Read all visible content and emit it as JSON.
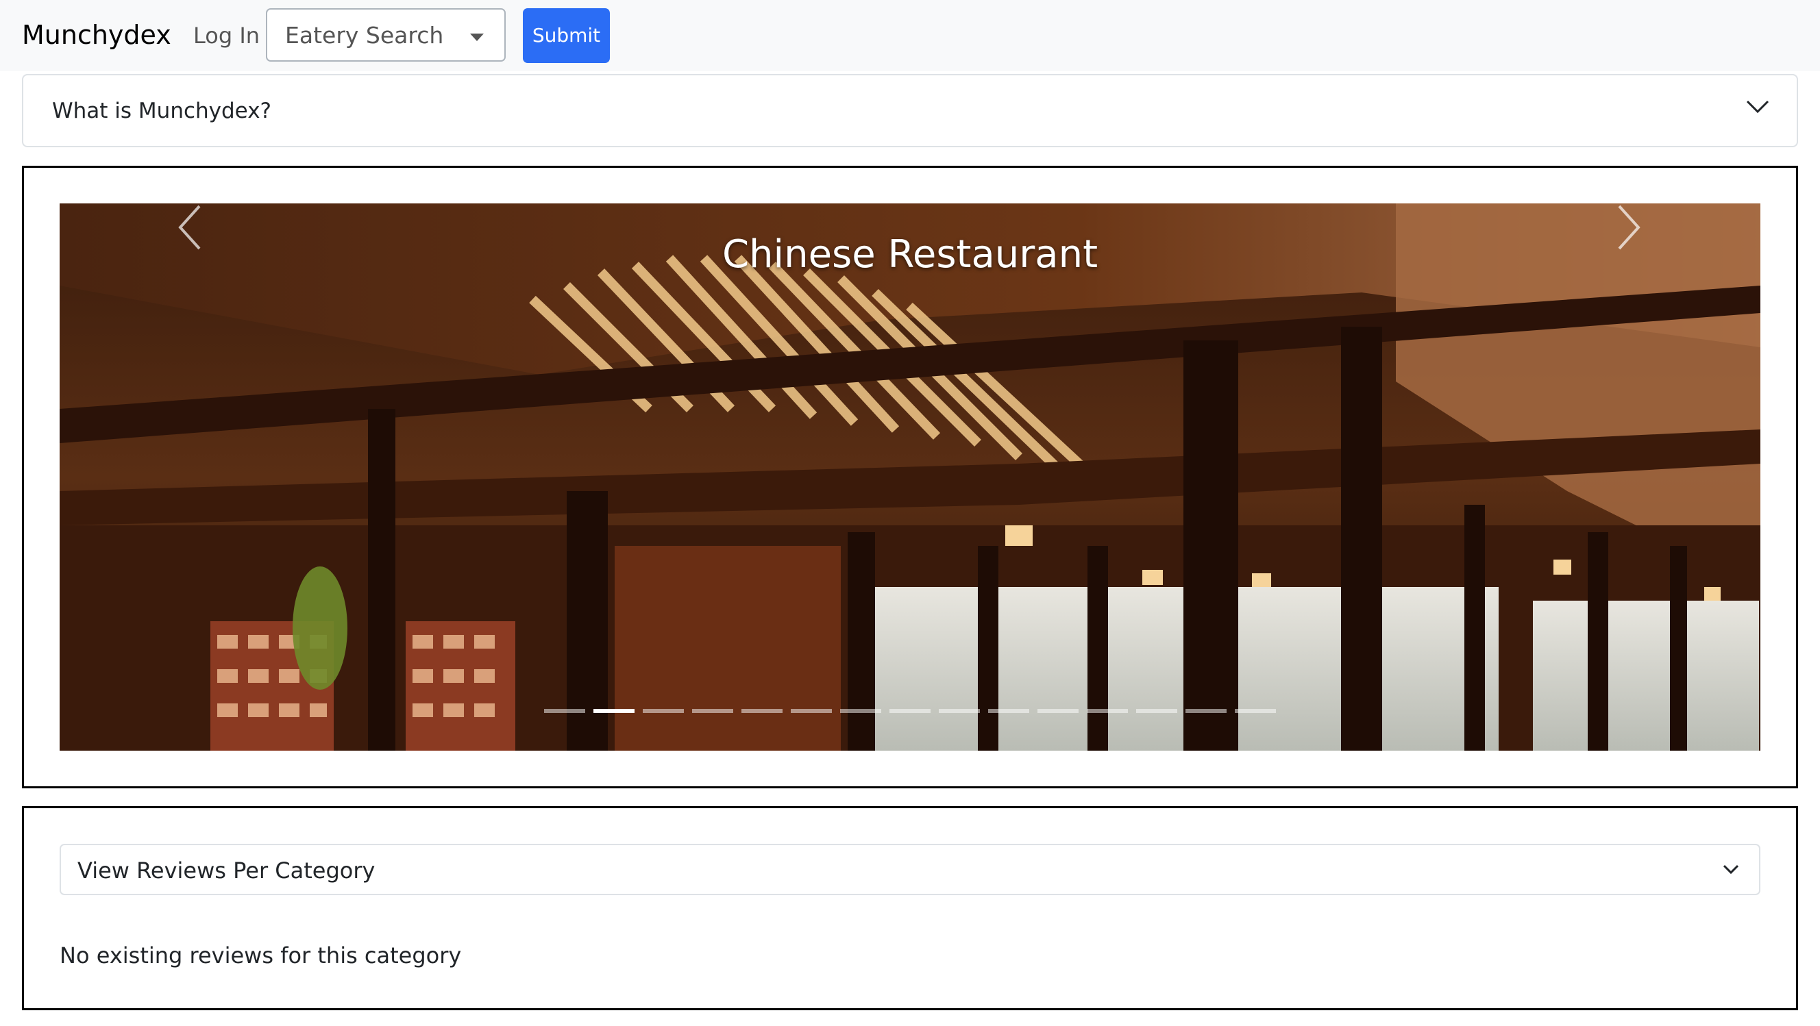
{
  "navbar": {
    "brand": "Munchydex",
    "login_label": "Log In",
    "search_select": {
      "selected": "Eatery Search"
    },
    "submit_label": "Submit",
    "background": "#f8f9fa",
    "accent": "#2b6df5"
  },
  "accordion": {
    "title": "What is Munchydex?",
    "icon": "chevron-down-icon"
  },
  "carousel": {
    "caption": "Chinese Restaurant",
    "prev_icon": "chevron-left-icon",
    "next_icon": "chevron-right-icon",
    "indicator_count": 15,
    "active_index": 1
  },
  "reviews": {
    "category_select": {
      "selected": "View Reviews Per Category",
      "icon": "chevron-down-icon"
    },
    "empty_message": "No existing reviews for this category"
  }
}
